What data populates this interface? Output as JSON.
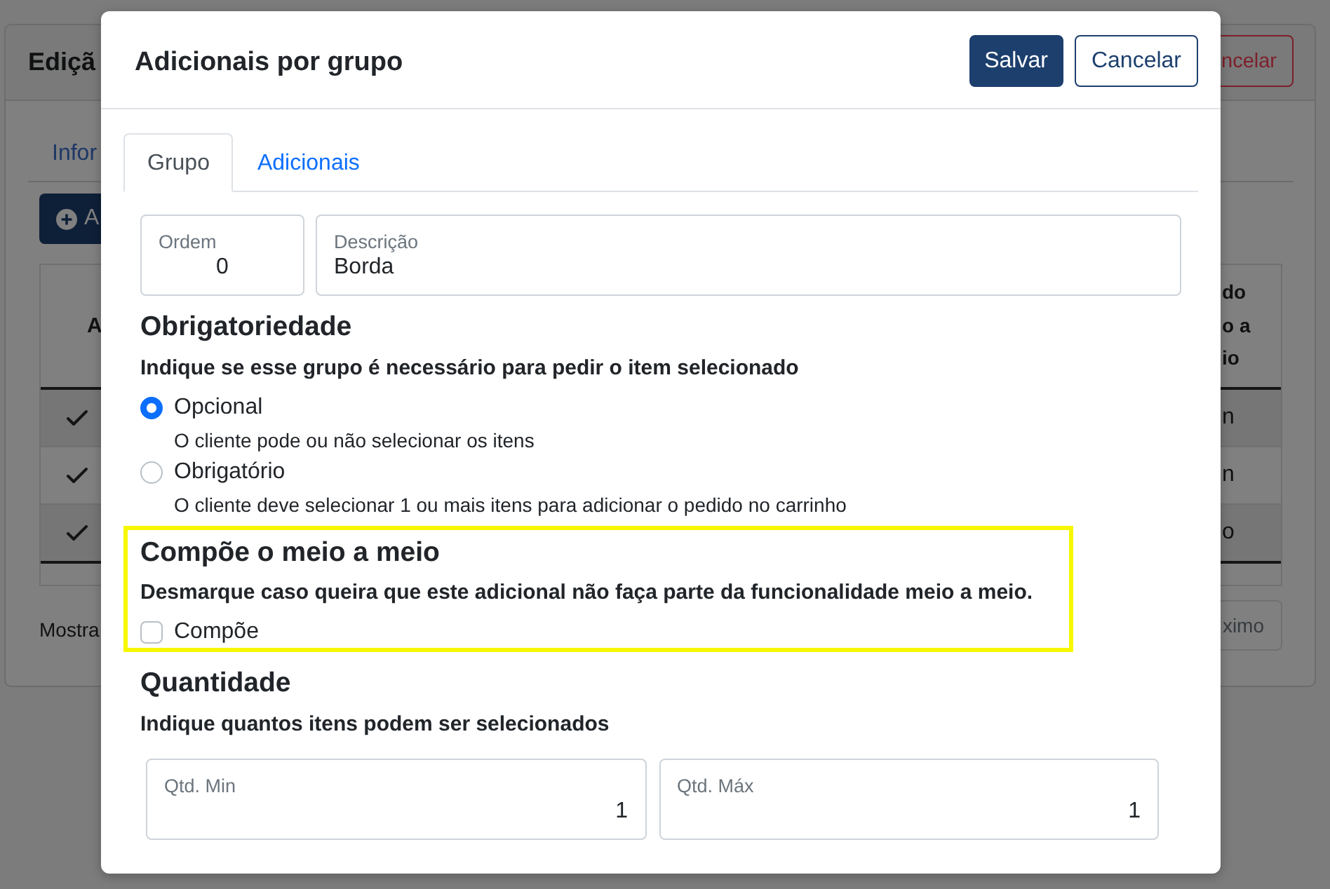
{
  "background_page": {
    "title": "Ediçã",
    "header_button": "ncelar",
    "tab": "Infor",
    "add_button": "A",
    "table": {
      "first_column_header": "A",
      "last_column_header": [
        "do",
        "o a",
        "io"
      ],
      "rows": [
        {
          "checked": true,
          "last_column": "n"
        },
        {
          "checked": true,
          "last_column": "n"
        },
        {
          "checked": true,
          "last_column": "o"
        }
      ]
    },
    "footer_text": "Mostra",
    "footer_button": "ximo"
  },
  "modal": {
    "title": "Adicionais por grupo",
    "buttons": [
      {
        "label": "Salvar",
        "kind": "primary"
      },
      {
        "label": "Cancelar",
        "kind": "outline"
      }
    ],
    "tabs": [
      {
        "label": "Grupo",
        "selected": true
      },
      {
        "label": "Adicionais",
        "selected": false
      }
    ],
    "fields": [
      {
        "label": "Ordem",
        "value": "0"
      },
      {
        "label": "Descrição",
        "value": "Borda"
      }
    ],
    "sections": [
      {
        "kind": "radio",
        "highlighted": false,
        "title": "Obrigatoriedade",
        "description": "Indique se esse grupo é necessário para pedir o item selecionado",
        "options": [
          {
            "label": "Opcional",
            "hint": "O cliente pode ou não selecionar os itens",
            "selected": true
          },
          {
            "label": "Obrigatório",
            "hint": "O cliente deve selecionar 1 ou mais itens para adicionar o pedido no carrinho",
            "selected": false
          }
        ]
      },
      {
        "kind": "checkbox",
        "highlighted": true,
        "title": "Compõe o meio a meio",
        "description": "Desmarque caso queira que este adicional não faça parte da funcionalidade meio a meio.",
        "options": [
          {
            "label": "Compõe",
            "checked": false
          }
        ]
      },
      {
        "kind": "fields",
        "highlighted": false,
        "title": "Quantidade",
        "description": "Indique quantos itens podem ser selecionados",
        "fields": [
          {
            "label": "Qtd. Min",
            "value": "1"
          },
          {
            "label": "Qtd. Máx",
            "value": "1"
          }
        ]
      }
    ]
  }
}
